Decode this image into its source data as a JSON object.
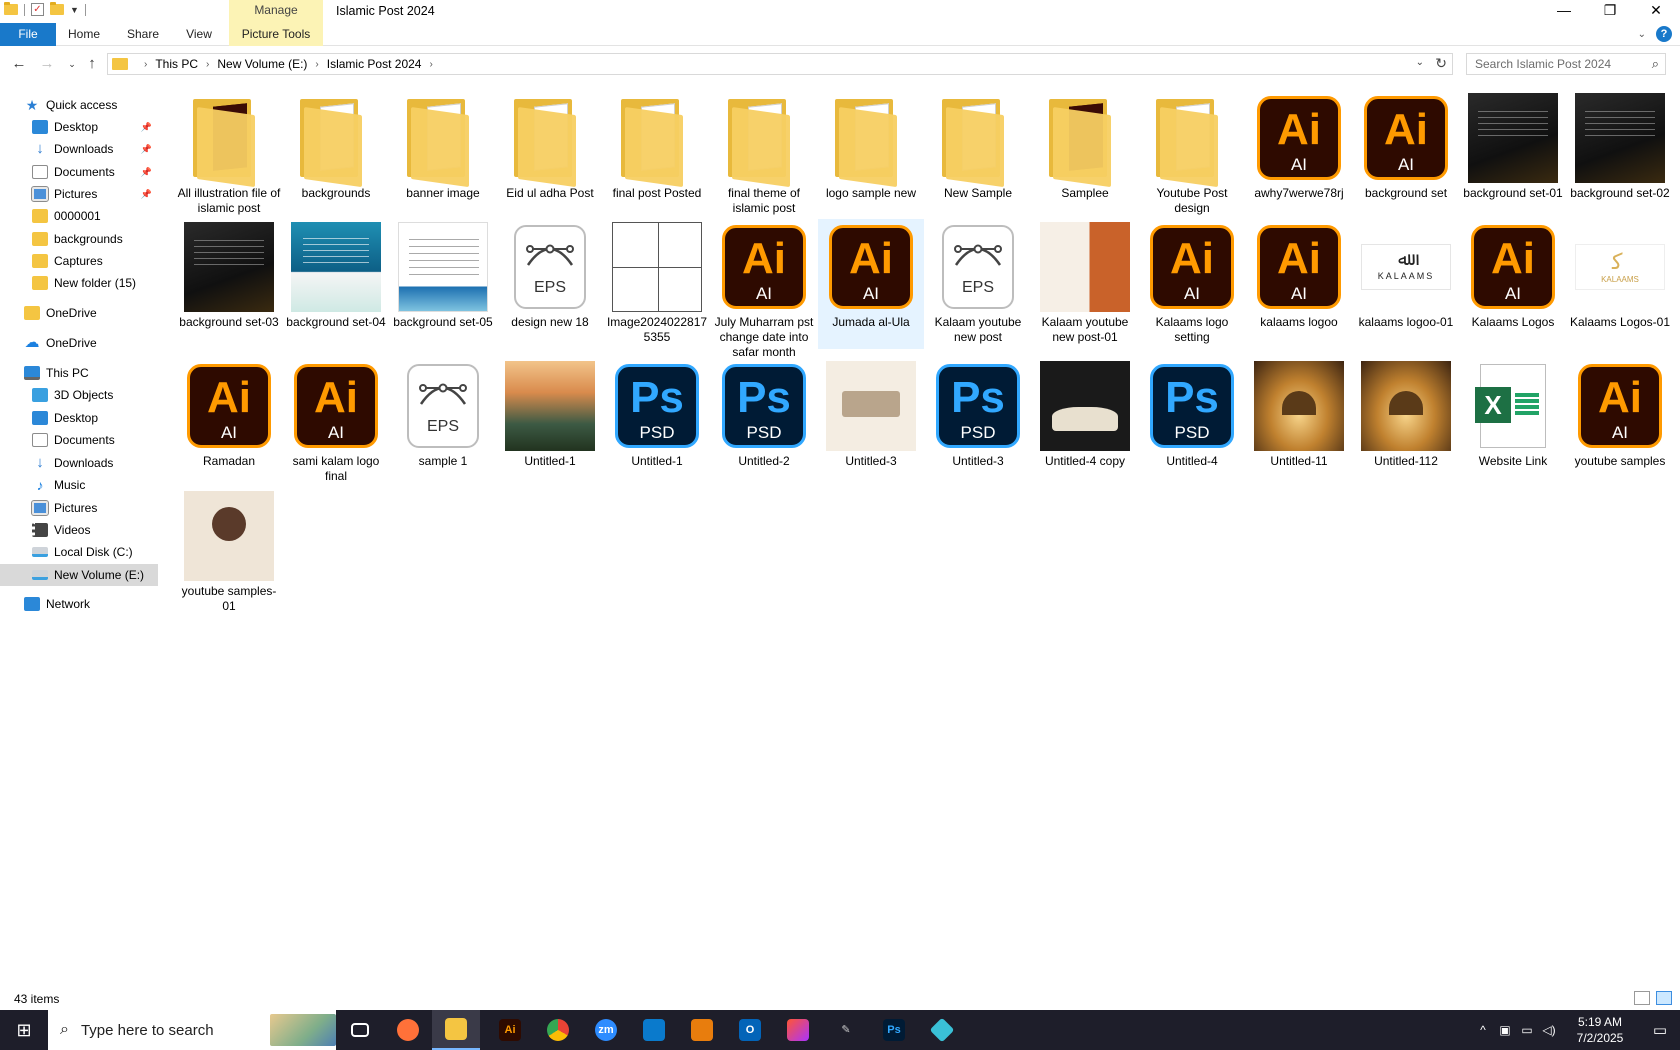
{
  "window": {
    "title": "Islamic Post 2024",
    "manage_tab": "Manage",
    "controls": {
      "minimize": "—",
      "maximize": "❐",
      "close": "✕"
    }
  },
  "ribbon": {
    "tabs": [
      "File",
      "Home",
      "Share",
      "View",
      "Picture Tools"
    ],
    "help": "?"
  },
  "address": {
    "crumbs": [
      "This PC",
      "New Volume (E:)",
      "Islamic Post 2024"
    ],
    "search_placeholder": "Search Islamic Post 2024"
  },
  "sidebar": {
    "items": [
      {
        "label": "Quick access",
        "icon": "star-icon",
        "pinned": false
      },
      {
        "label": "Desktop",
        "icon": "desktop-icon",
        "pinned": true
      },
      {
        "label": "Downloads",
        "icon": "download-icon",
        "pinned": true
      },
      {
        "label": "Documents",
        "icon": "documents-icon",
        "pinned": true
      },
      {
        "label": "Pictures",
        "icon": "pictures-icon",
        "pinned": true
      },
      {
        "label": "0000001",
        "icon": "folder-icon",
        "pinned": false
      },
      {
        "label": "backgrounds",
        "icon": "folder-icon",
        "pinned": false
      },
      {
        "label": "Captures",
        "icon": "folder-icon",
        "pinned": false
      },
      {
        "label": "New folder (15)",
        "icon": "folder-icon",
        "pinned": false
      },
      {
        "label": "OneDrive",
        "icon": "folder-icon",
        "pinned": false
      },
      {
        "label": "OneDrive",
        "icon": "cloud-icon",
        "pinned": false
      },
      {
        "label": "This PC",
        "icon": "computer-icon",
        "pinned": false
      },
      {
        "label": "3D Objects",
        "icon": "cube-icon",
        "pinned": false
      },
      {
        "label": "Desktop",
        "icon": "desktop-icon",
        "pinned": false
      },
      {
        "label": "Documents",
        "icon": "documents-icon",
        "pinned": false
      },
      {
        "label": "Downloads",
        "icon": "download-icon",
        "pinned": false
      },
      {
        "label": "Music",
        "icon": "music-icon",
        "pinned": false
      },
      {
        "label": "Pictures",
        "icon": "pictures-icon",
        "pinned": false
      },
      {
        "label": "Videos",
        "icon": "video-icon",
        "pinned": false
      },
      {
        "label": "Local Disk (C:)",
        "icon": "disk-icon",
        "pinned": false
      },
      {
        "label": "New Volume (E:)",
        "icon": "drive-icon",
        "pinned": false,
        "selected": true
      },
      {
        "label": "Network",
        "icon": "network-icon",
        "pinned": false
      }
    ]
  },
  "files": [
    {
      "name": "All illustration file of islamic post",
      "kind": "folder",
      "preview": "ai"
    },
    {
      "name": "backgrounds",
      "kind": "folder",
      "preview": "doc"
    },
    {
      "name": "banner image",
      "kind": "folder",
      "preview": "doc"
    },
    {
      "name": "Eid ul adha Post",
      "kind": "folder",
      "preview": "photo"
    },
    {
      "name": "final post Posted",
      "kind": "folder",
      "preview": "eps"
    },
    {
      "name": "final theme of islamic post",
      "kind": "folder",
      "preview": "eps"
    },
    {
      "name": "logo sample new",
      "kind": "folder",
      "preview": "logo"
    },
    {
      "name": "New Sample",
      "kind": "folder",
      "preview": "eps"
    },
    {
      "name": "Samplee",
      "kind": "folder",
      "preview": "ai"
    },
    {
      "name": "Youtube Post design",
      "kind": "folder",
      "preview": "photo"
    },
    {
      "name": "awhy7werwe78rj",
      "kind": "ai"
    },
    {
      "name": "background set",
      "kind": "ai"
    },
    {
      "name": "background set-01",
      "kind": "image",
      "style": "dark"
    },
    {
      "name": "background set-02",
      "kind": "image",
      "style": "dark"
    },
    {
      "name": "background set-03",
      "kind": "image",
      "style": "dark"
    },
    {
      "name": "background set-04",
      "kind": "image",
      "style": "teal"
    },
    {
      "name": "background set-05",
      "kind": "image",
      "style": "white"
    },
    {
      "name": "design new 18",
      "kind": "eps"
    },
    {
      "name": "Image2024022817 5355",
      "kind": "image",
      "style": "grid4"
    },
    {
      "name": "July Muharram pst change date into safar month",
      "kind": "ai"
    },
    {
      "name": "Jumada al-Ula",
      "kind": "ai",
      "hover": true
    },
    {
      "name": "Kalaam youtube new post",
      "kind": "eps"
    },
    {
      "name": "Kalaam youtube new post-01",
      "kind": "image",
      "style": "orangeportrait"
    },
    {
      "name": "Kalaams logo setting",
      "kind": "ai"
    },
    {
      "name": "kalaams logoo",
      "kind": "ai"
    },
    {
      "name": "kalaams logoo-01",
      "kind": "logo-white"
    },
    {
      "name": "Kalaams Logos",
      "kind": "ai"
    },
    {
      "name": "Kalaams Logos-01",
      "kind": "logo-gold"
    },
    {
      "name": "Ramadan",
      "kind": "ai"
    },
    {
      "name": "sami kalam logo final",
      "kind": "ai"
    },
    {
      "name": "sample 1",
      "kind": "eps"
    },
    {
      "name": "Untitled-1",
      "kind": "image",
      "style": "sky"
    },
    {
      "name": "Untitled-1",
      "kind": "psd"
    },
    {
      "name": "Untitled-2",
      "kind": "psd"
    },
    {
      "name": "Untitled-3",
      "kind": "image",
      "style": "cream"
    },
    {
      "name": "Untitled-3",
      "kind": "psd"
    },
    {
      "name": "Untitled-4 copy",
      "kind": "image",
      "style": "bookdark"
    },
    {
      "name": "Untitled-4",
      "kind": "psd"
    },
    {
      "name": "Untitled-11",
      "kind": "image",
      "style": "mosque"
    },
    {
      "name": "Untitled-112",
      "kind": "image",
      "style": "mosque"
    },
    {
      "name": "Website Link",
      "kind": "xlsx"
    },
    {
      "name": "youtube samples",
      "kind": "ai"
    },
    {
      "name": "youtube samples-01",
      "kind": "image",
      "style": "beige"
    }
  ],
  "badges": {
    "ai_big": "Ai",
    "ai_small": "AI",
    "ps_big": "Ps",
    "ps_small": "PSD",
    "eps_small": "EPS",
    "xl": "X",
    "logo_white_text": "KALAAMS",
    "logo_gold_text": "KALAAMS"
  },
  "status": {
    "count": "43 items"
  },
  "taskbar": {
    "search_placeholder": "Type here to search",
    "apps": [
      "task-view",
      "firefox",
      "file-explorer",
      "illustrator",
      "chrome",
      "zoom",
      "vscode",
      "blender",
      "outlook",
      "creative-cloud",
      "pen-tool",
      "photoshop",
      "app-diamond"
    ],
    "time": "5:19 AM",
    "date": "7/2/2025"
  },
  "colors": {
    "accent": "#1979ca",
    "manage": "#fcf3b5",
    "ai": "#ff9a00",
    "ps": "#31a8ff",
    "selected": "#d9d9d9"
  }
}
